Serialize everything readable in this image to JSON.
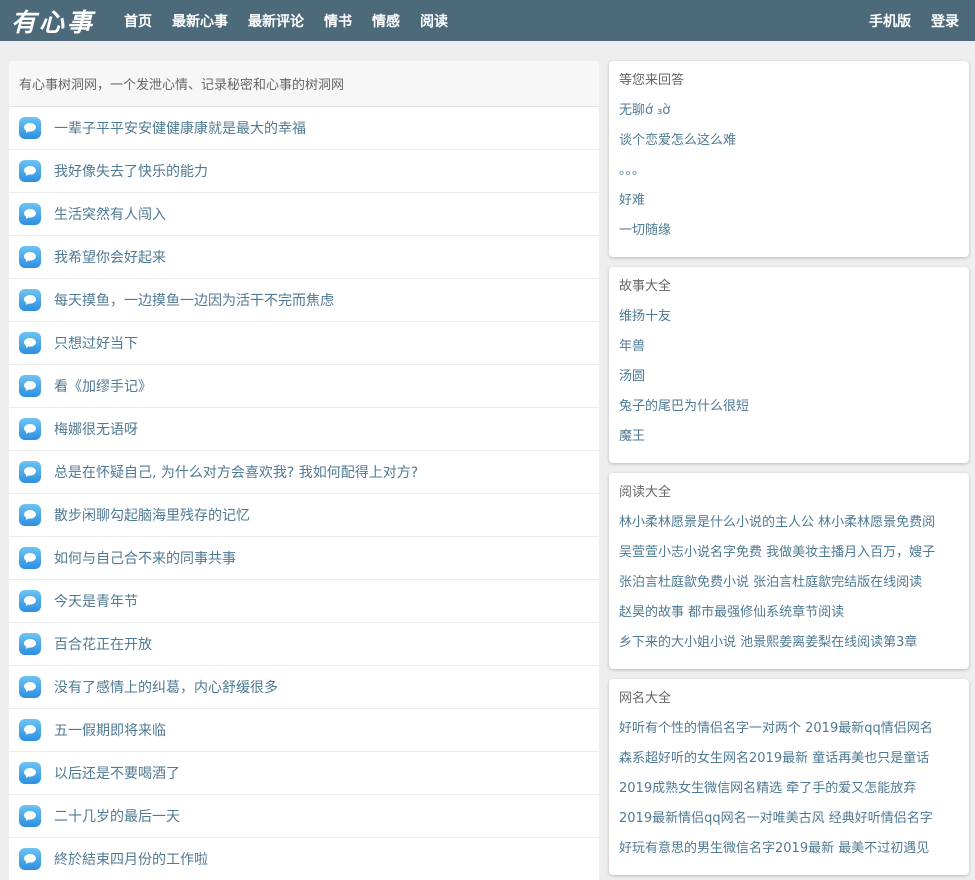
{
  "header": {
    "logo": "有心事",
    "nav": [
      "首页",
      "最新心事",
      "最新评论",
      "情书",
      "情感",
      "阅读"
    ],
    "right_nav": [
      "手机版",
      "登录"
    ]
  },
  "main": {
    "intro": "有心事树洞网，一个发泄心情、记录秘密和心事的树洞网",
    "items": [
      "一辈子平平安安健健康康就是最大的幸福",
      "我好像失去了快乐的能力",
      "生活突然有人闯入",
      "我希望你会好起来",
      "每天摸鱼，一边摸鱼一边因为活干不完而焦虑",
      "只想过好当下",
      "看《加缪手记》",
      "梅娜很无语呀",
      "总是在怀疑自己, 为什么对方会喜欢我? 我如何配得上对方?",
      "散步闲聊勾起脑海里残存的记忆",
      "如何与自己合不来的同事共事",
      "今天是青年节",
      "百合花正在开放",
      "没有了感情上的纠葛，内心舒缓很多",
      "五一假期即将来临",
      "以后还是不要喝酒了",
      "二十几岁的最后一天",
      "終於結束四月份的工作啦"
    ]
  },
  "sidebar": {
    "answer": {
      "title": "等您来回答",
      "links": [
        "无聊ớ ₃ờ",
        "谈个恋爱怎么这么难",
        "。。。",
        "好难",
        "一切随缘"
      ]
    },
    "stories": {
      "title": "故事大全",
      "links": [
        "维扬十友",
        "年兽",
        "汤圆",
        "兔子的尾巴为什么很短",
        "魔王"
      ]
    },
    "reading": {
      "title": "阅读大全",
      "links": [
        "林小柔林愿景是什么小说的主人公 林小柔林愿景免费阅",
        "吴萱萱小志小说名字免费 我做美妆主播月入百万，嫂子",
        "张泊言杜庭歙免费小说 张泊言杜庭歙完结版在线阅读",
        "赵昊的故事 都市最强修仙系统章节阅读",
        "乡下来的大小姐小说 池景熙姜离姜梨在线阅读第3章"
      ]
    },
    "netnames": {
      "title": "网名大全",
      "links": [
        "好听有个性的情侣名字一对两个 2019最新qq情侣网名",
        "森系超好听的女生网名2019最新 童话再美也只是童话",
        "2019成熟女生微信网名精选 牵了手的爱又怎能放弃",
        "2019最新情侣qq网名一对唯美古风 经典好听情侣名字",
        "好玩有意思的男生微信名字2019最新 最美不过初遇见"
      ]
    }
  }
}
